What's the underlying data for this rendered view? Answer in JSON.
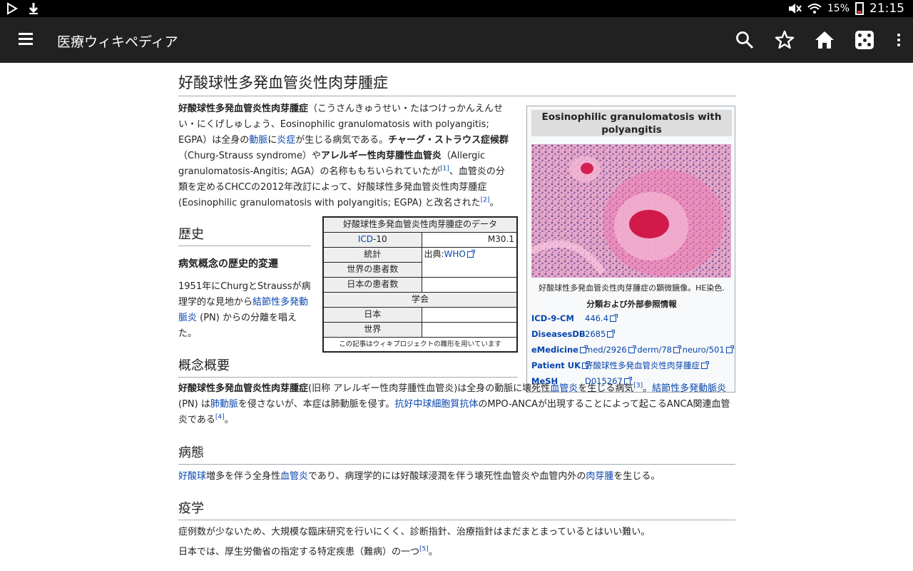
{
  "status_bar": {
    "battery": "15%",
    "time": "21:15"
  },
  "app_bar": {
    "title": "医療ウィキペディア",
    "icons": [
      "menu-icon",
      "search-icon",
      "star-icon",
      "home-icon",
      "dice-icon",
      "more-vert-icon"
    ]
  },
  "article": {
    "title": "好酸球性多発血管炎性肉芽腫症",
    "intro": {
      "b1": "好酸球性多発血管炎性肉芽腫症",
      "t1": "（こうさんきゅうせい・たはつけっかんえんせい・にくげしゅしょう、Eosinophilic granulomatosis with polyangitis; EGPA）は全身の",
      "l1": "動脈",
      "t2": "に",
      "l2": "炎症",
      "t3": "が生じる病気である。",
      "b2": "チャーグ・ストラウス症候群",
      "t4": "（Churg-Strauss syndrome）や",
      "b3": "アレルギー性肉芽腫性血管炎",
      "t5": "（Allergic granulomatosis-Angitis; AGA）の名称ももちいられていたが",
      "r1": "[1]",
      "t6": "、血管炎の分類を定めるCHCCの2012年改訂によって、好酸球性多発血管炎性肉芽腫症(Eosinophilic granulomatosis with polyangitis; EGPA) と改名された",
      "r2": "[2]",
      "t7": "。"
    },
    "history": {
      "heading": "歴史",
      "subheading": "病気概念の歴史的変遷",
      "t1": "1951年にChurgとStraussが病理学的な見地から",
      "l1": "結節性多発動脈炎",
      "t2": " (PN) からの分離を唱えた。"
    },
    "overview": {
      "heading": "概念概要",
      "b1": "好酸球性多発血管炎性肉芽腫症",
      "t1": "(旧称 アレルギー性肉芽腫性血管炎)は全身の動脈に壊死性",
      "l1": "血管炎",
      "t2": "を生じる病気",
      "r1": "[3]",
      "t3": "。",
      "l2": "結節性多発動脈炎",
      "t4": " (PN) は",
      "l3": "肺動脈",
      "t5": "を侵さないが、本症は肺動脈を侵す。",
      "l4": "抗好中球細胞質抗体",
      "t6": "のMPO-ANCAが出現することによって起こるANCA関連血管炎である",
      "r2": "[4]",
      "t7": "。"
    },
    "pathology": {
      "heading": "病態",
      "l1": "好酸球",
      "t1": "増多を伴う全身性",
      "l2": "血管炎",
      "t2": "であり、病理学的には好酸球浸潤を伴う壊死性血管炎や血管内外の",
      "l3": "肉芽腫",
      "t3": "を生じる。"
    },
    "epidemiology": {
      "heading": "疫学",
      "p1": "症例数が少ないため、大規模な臨床研究を行いにくく、診断指針、治療指針はまだまとまっているとはいい難い。",
      "p2": "日本では、厚生労働省の指定する特定疾患（難病）の一つ",
      "r1": "[5]",
      "p2_end": "。"
    }
  },
  "data_table": {
    "caption": "好酸球性多発血管炎性肉芽腫症のデータ",
    "icd_link": "ICD",
    "icd_suffix": "-10",
    "icd_value": "M30.1",
    "stats_label": "統計",
    "source_prefix": "出典:",
    "source_link": "WHO",
    "world_patients": "世界の患者数",
    "japan_patients": "日本の患者数",
    "society_header": "学会",
    "japan": "日本",
    "world": "世界",
    "footer": "この記事はウィキプロジェクトの雛形を用いています"
  },
  "infobox": {
    "title": "Eosinophilic granulomatosis with polyangitis",
    "caption": "好酸球性多発血管炎性肉芽腫症の顕微鏡像。HE染色.",
    "subheading": "分類および外部参照情報",
    "rows": [
      {
        "key": "ICD-9-CM",
        "values": [
          "446.4"
        ]
      },
      {
        "key": "DiseasesDB",
        "values": [
          "2685"
        ]
      },
      {
        "key": "eMedicine",
        "values": [
          "med/2926",
          "derm/78",
          "neuro/501"
        ]
      },
      {
        "key": "Patient UK",
        "values": [
          "好酸球性多発血管炎性肉芽腫症"
        ]
      },
      {
        "key": "MeSH",
        "values": [
          "D015267"
        ]
      }
    ]
  }
}
